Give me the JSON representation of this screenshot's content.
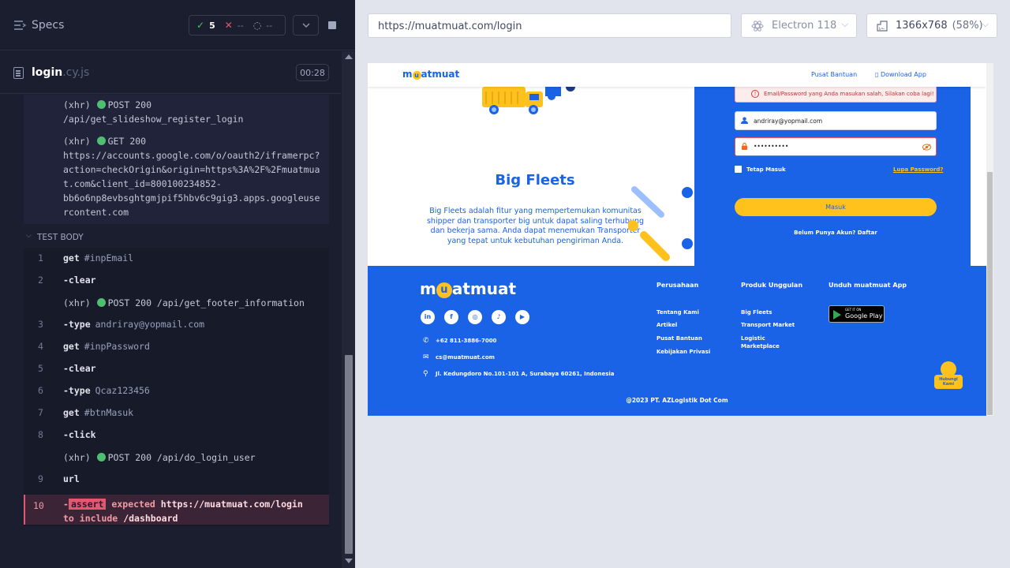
{
  "runner": {
    "specs_label": "Specs",
    "passed_count": "5",
    "failed_count": "--",
    "pending_count": "--",
    "spec_file": "login",
    "spec_ext": ".cy.js",
    "timer": "00:28"
  },
  "command_log": {
    "xhr_prefix": "(xhr)",
    "pre_requests": [
      {
        "method": "POST 200",
        "lines": [
          "/api/get_slideshow_register_login"
        ]
      },
      {
        "method": "GET 200",
        "lines": [
          "https://accounts.google.com/o/oauth2/iframerpc?",
          "action=checkOrigin&origin=https%3A%2F%2Fmuatmua",
          "t.com&client_id=800100234852-",
          "bb6o6np8evbsghtgmjpif5hbv6c9gig3.apps.googleuse",
          "rcontent.com"
        ]
      }
    ],
    "test_body_label": "TEST BODY",
    "steps": [
      {
        "num": "1",
        "cmd": "get",
        "arg": "#inpEmail"
      },
      {
        "num": "2",
        "cmd": "-clear",
        "arg": ""
      },
      {
        "num": "",
        "cmd": "(xhr)",
        "arg": "POST 200 /api/get_footer_information",
        "xhr": true
      },
      {
        "num": "3",
        "cmd": "-type",
        "arg": "andriray@yopmail.com"
      },
      {
        "num": "4",
        "cmd": "get",
        "arg": "#inpPassword"
      },
      {
        "num": "5",
        "cmd": "-clear",
        "arg": ""
      },
      {
        "num": "6",
        "cmd": "-type",
        "arg": "Qcaz123456"
      },
      {
        "num": "7",
        "cmd": "get",
        "arg": "#btnMasuk"
      },
      {
        "num": "8",
        "cmd": "-click",
        "arg": ""
      },
      {
        "num": "",
        "cmd": "(xhr)",
        "arg": "POST 200 /api/do_login_user",
        "xhr": true
      },
      {
        "num": "9",
        "cmd": "url",
        "arg": ""
      }
    ],
    "error": {
      "num": "10",
      "prefix": "-",
      "tag": "assert",
      "expected": "expected",
      "url": "https://muatmuat.com/login",
      "to_include": "to include",
      "path": "/dashboard"
    }
  },
  "browser": {
    "url": "https://muatmuat.com/login",
    "engine": "Electron 118",
    "viewport": "1366x768",
    "scale": "(58%)"
  },
  "site": {
    "logo": {
      "m": "m",
      "u": "u",
      "rest": "atmuat"
    },
    "nav_links": [
      "Pusat Bantuan",
      "Download App"
    ],
    "slide": {
      "title": "Big Fleets",
      "desc": "Big Fleets adalah fitur yang mempertemukan komunitas shipper dan transporter big untuk dapat saling terhubung dan bekerja sama. Anda dapat menemukan Transporter yang tepat untuk kebutuhan pengiriman Anda."
    },
    "alert": "Email/Password yang Anda masukan salah, Silakan coba lagi!",
    "email_value": "andriray@yopmail.com",
    "password_value": "••••••••••",
    "remember_label": "Tetap Masuk",
    "forgot_label": "Lupa Password?",
    "login_btn": "Masuk",
    "register_text": "Belum Punya Akun?  Daftar",
    "footer": {
      "phone": "+62 811-3886-7000",
      "email": "cs@muatmuat.com",
      "address": "Jl. Kedungdoro No.101-101 A, Surabaya 60261, Indonesia",
      "col1_title": "Perusahaan",
      "col1": [
        "Tentang Kami",
        "Artikel",
        "Pusat Bantuan",
        "Kebijakan Privasi"
      ],
      "col2_title": "Produk Unggulan",
      "col2": [
        "Big Fleets",
        "Transport Market",
        "Logistic",
        "Marketplace"
      ],
      "col3_title": "Unduh muatmuat App",
      "gplay_small": "GET IT ON",
      "gplay_big": "Google Play",
      "copyright": "@2023 PT. AZLogistik Dot Com",
      "hubungi": [
        "Hubungi",
        "Kami"
      ]
    }
  }
}
